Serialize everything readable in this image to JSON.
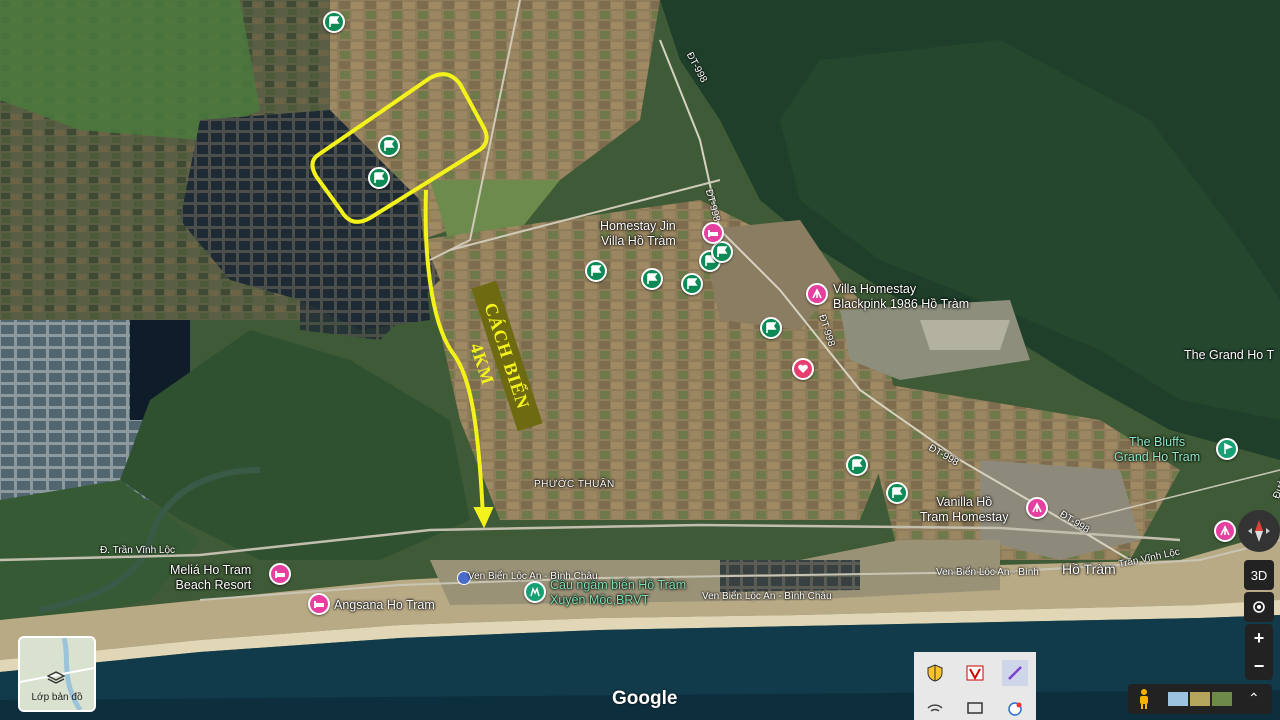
{
  "map": {
    "annotation_label": "CÁCH BIỂN 4KM",
    "area_labels": {
      "phuoc_thuan": "PHƯỚC THUẬN",
      "ho_tram": "Hồ Tràm",
      "the_grand": "The Grand Ho T",
      "bluffs_1": "The Bluffs",
      "bluffs_2": "Grand Ho Tram"
    },
    "places": {
      "homestay_jin_1": "Homestay Jin",
      "homestay_jin_2": "Villa Hồ Tràm",
      "villa_blackpink_1": "Villa Homestay",
      "villa_blackpink_2": "Blackpink 1986 Hồ Tràm",
      "vanilla_1": "Vanilla Hồ",
      "vanilla_2": "Tram Homestay",
      "melia_1": "Meliá Ho Tram",
      "melia_2": "Beach Resort",
      "angsana": "Angsana Ho Tram",
      "cau_ngam_1": "Cầu ngầm biển Hồ Tràm",
      "cau_ngam_2": "Xuyên Mộc,BRVT"
    },
    "roads": {
      "dt998_a": "ĐT-998",
      "dt998_b": "ĐT-998",
      "dt998_c": "ĐT-998",
      "dt998_d": "ĐT-998",
      "dt998_e": "ĐT-998",
      "tran_vinh_loc_w": "Đ. Trần Vĩnh Lộc",
      "tran_vinh_loc_e": "Trần Vĩnh Lộc",
      "ven_bien_1": "Ven Biển Lộc An - Bình Châu",
      "ven_bien_2": "Ven Biển Lộc An - Bình Châu",
      "ven_bien_3": "Ven Biển Lộc An - Bình Châ",
      "ven_bien_short": "Ven Biển Lộc An - Bình",
      "duong": "Đường"
    },
    "logo": "Google"
  },
  "controls": {
    "layers_label": "Lớp bản đồ",
    "btn_3d": "3D",
    "zoom_in": "+",
    "zoom_out": "−",
    "expand": "⌃"
  },
  "colors": {
    "annotation": "#f4f21b",
    "green_pin": "#0d8a55",
    "pink_pin": "#e63f9f"
  }
}
